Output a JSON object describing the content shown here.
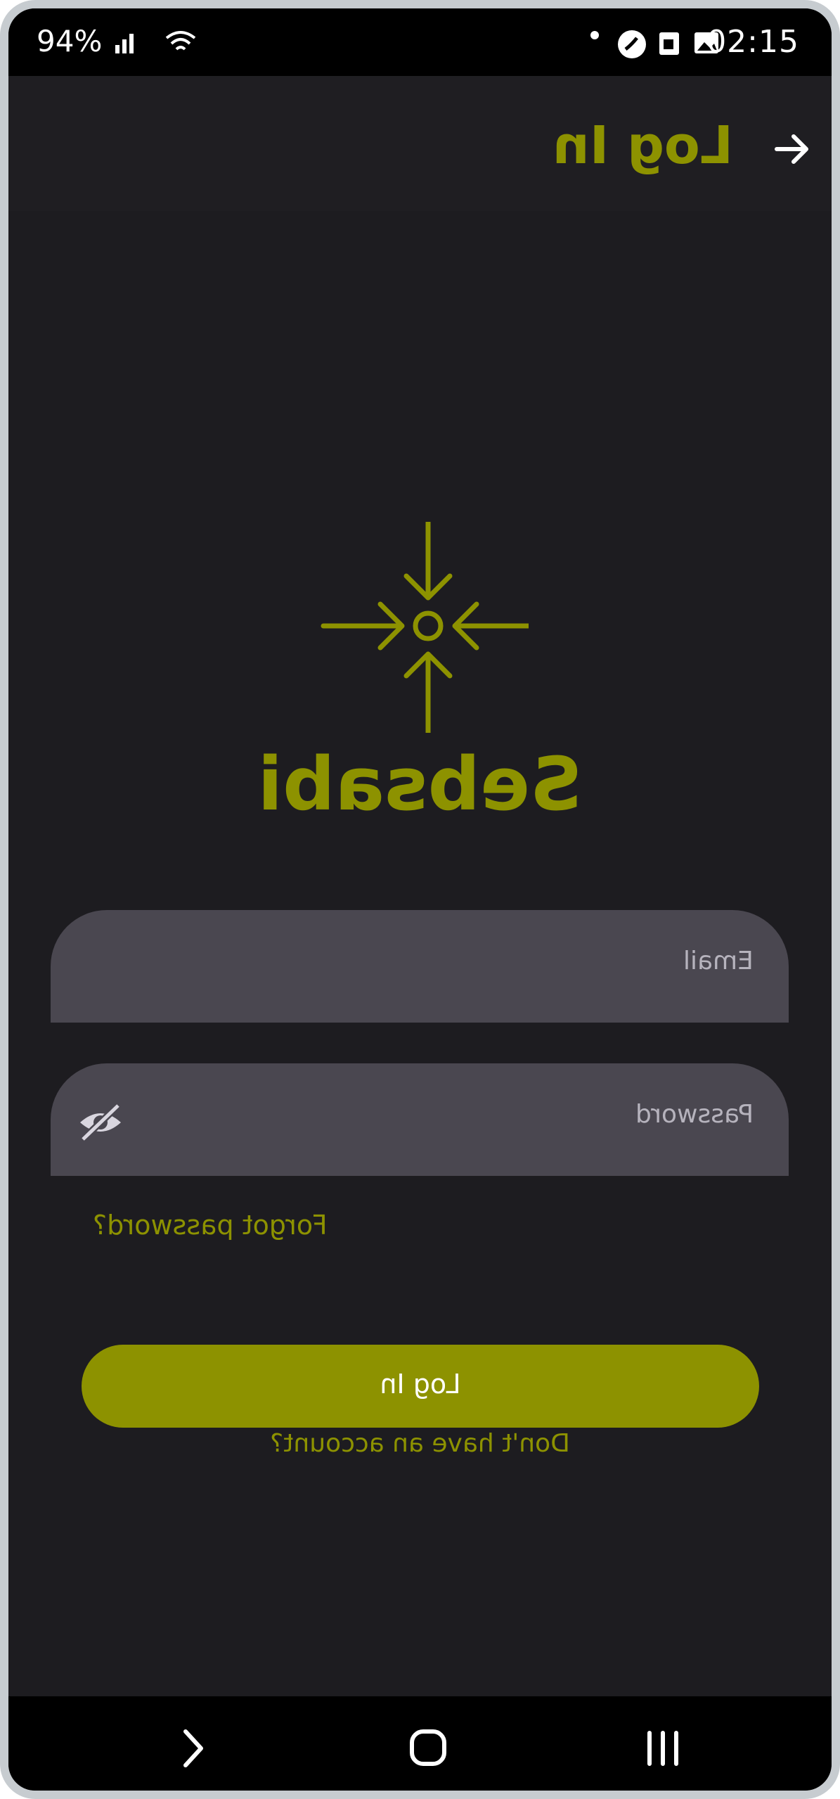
{
  "status_bar": {
    "time": "02:15",
    "battery": "94%",
    "icons": [
      "phone-icon",
      "sim-icon",
      "image-icon",
      "dot-icon",
      "signal-icon",
      "wifi-icon",
      "battery-icon"
    ]
  },
  "app_bar": {
    "title": "Log In",
    "back_icon": "arrow-icon"
  },
  "brand": {
    "name": "Sebsabi",
    "logo_icon": "converging-arrows-logo"
  },
  "form": {
    "email_label": "Email",
    "password_label": "Password",
    "password_toggle_icon": "eye-off-icon",
    "forgot_password": "Forgot password?",
    "login_button": "Log In",
    "signup_link": "Don't have an account?"
  },
  "nav_bar": {
    "icons": [
      "back-nav-icon",
      "home-nav-icon",
      "recents-nav-icon"
    ]
  },
  "colors": {
    "accent": "#8d9200",
    "background": "#1d1c20",
    "field": "#4a4750",
    "text": "#ffffff"
  }
}
